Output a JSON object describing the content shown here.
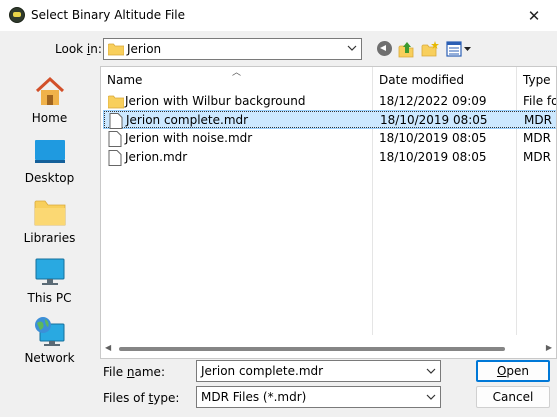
{
  "window": {
    "title": "Select Binary Altitude File",
    "close_glyph": "✕"
  },
  "toolbar": {
    "lookin_label_pre": "Look ",
    "lookin_label_accel": "i",
    "lookin_label_post": "n:",
    "lookin_value": "Jerion"
  },
  "places": [
    {
      "label": "Home",
      "icon": "home-icon"
    },
    {
      "label": "Desktop",
      "icon": "desktop-icon"
    },
    {
      "label": "Libraries",
      "icon": "libraries-icon"
    },
    {
      "label": "This PC",
      "icon": "this-pc-icon"
    },
    {
      "label": "Network",
      "icon": "network-icon"
    }
  ],
  "list": {
    "columns": {
      "name": "Name",
      "date": "Date modified",
      "type": "Type"
    },
    "rows": [
      {
        "name": "Jerion with Wilbur background",
        "date": "18/12/2022 09:09",
        "type": "File fo",
        "kind": "folder"
      },
      {
        "name": "Jerion complete.mdr",
        "date": "18/10/2019 08:05",
        "type": "MDR",
        "kind": "file",
        "selected": true
      },
      {
        "name": "Jerion with noise.mdr",
        "date": "18/10/2019 08:05",
        "type": "MDR",
        "kind": "file"
      },
      {
        "name": "Jerion.mdr",
        "date": "18/10/2019 08:05",
        "type": "MDR",
        "kind": "file"
      }
    ]
  },
  "footer": {
    "filename_label_pre": "File ",
    "filename_label_accel": "n",
    "filename_label_post": "ame:",
    "filename_value": "Jerion complete.mdr",
    "filetype_label_pre": "Files of ",
    "filetype_label_accel": "t",
    "filetype_label_post": "ype:",
    "filetype_value": "MDR Files (*.mdr)",
    "open_accel": "O",
    "open_rest": "pen",
    "cancel_label": "Cancel"
  },
  "colors": {
    "selection": "#cce8ff",
    "accent": "#0078d7",
    "folder": "#f8cf5c"
  }
}
